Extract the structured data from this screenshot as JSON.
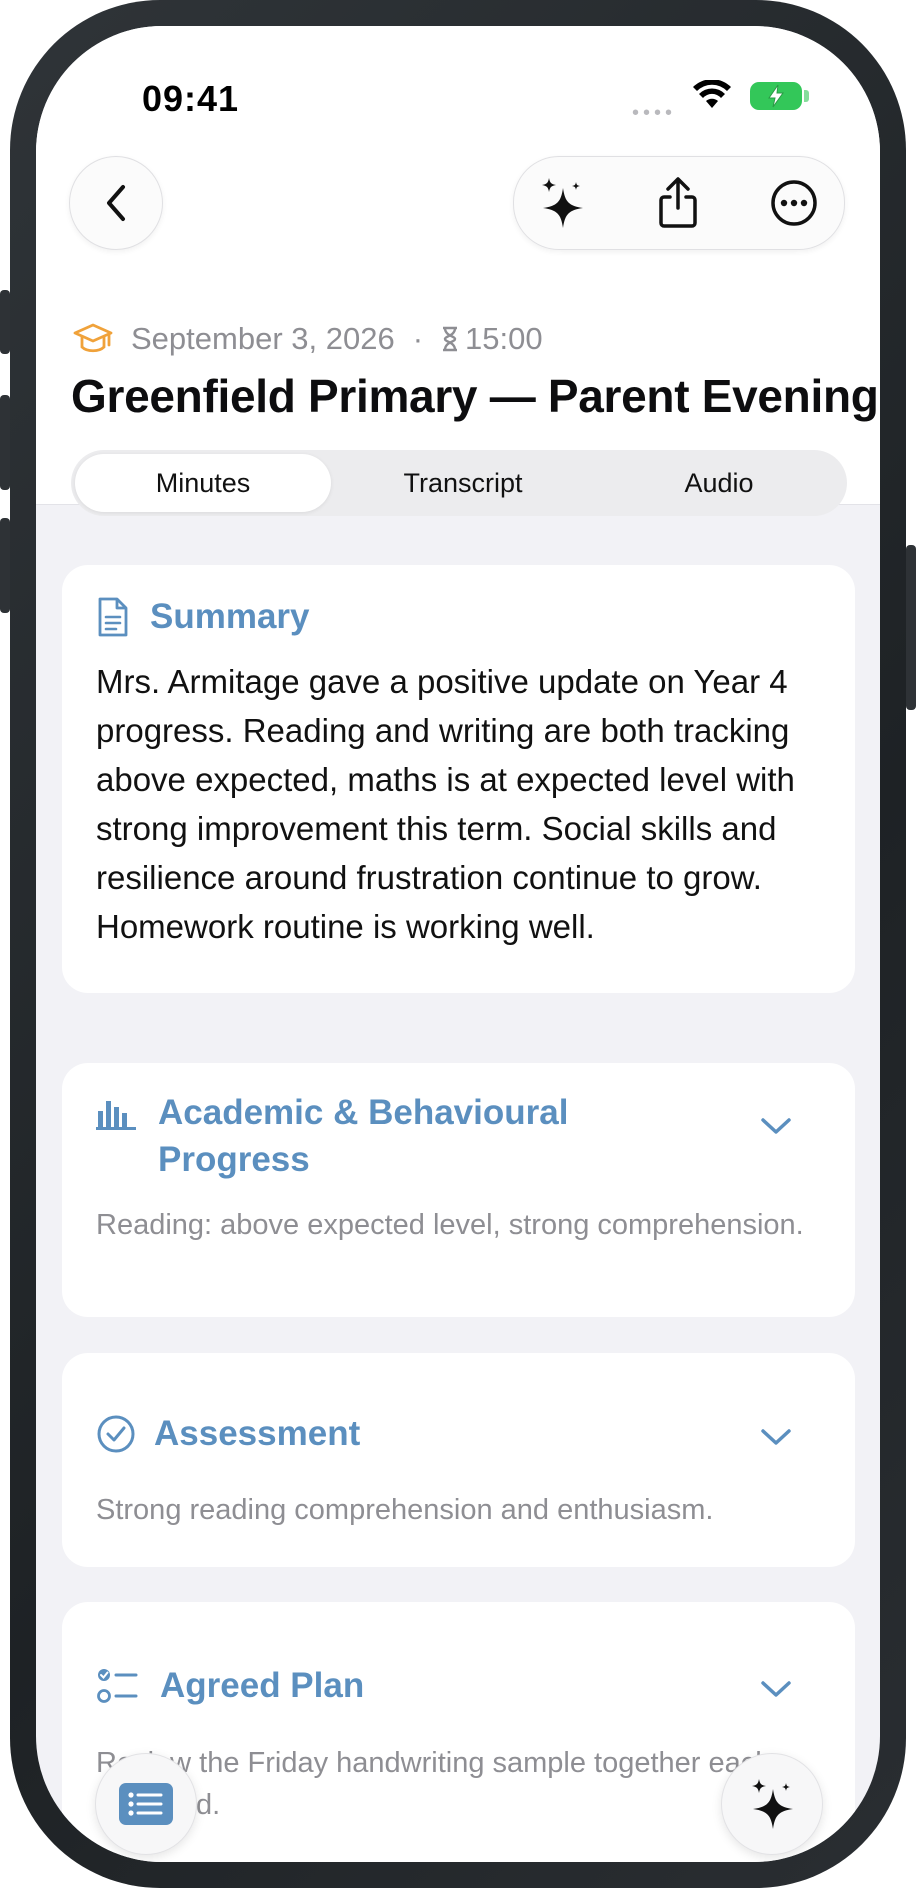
{
  "status_bar": {
    "time": "09:41",
    "signal": "••••"
  },
  "nav": {
    "back_icon": "chevron-left-icon",
    "actions": [
      "sparkles-icon",
      "share-icon",
      "more-icon"
    ]
  },
  "meeting": {
    "date": "September 3, 2026",
    "separator": "·",
    "duration": "15:00",
    "title": "Greenfield Primary — Parent Evening"
  },
  "tabs": [
    {
      "label": "Minutes",
      "active": true
    },
    {
      "label": "Transcript",
      "active": false
    },
    {
      "label": "Audio",
      "active": false
    }
  ],
  "summary": {
    "title": "Summary",
    "text": "Mrs. Armitage gave a positive update on Year 4 progress. Reading and writing are both tracking above expected, maths is at expected level with strong improvement this term. Social skills and resilience around frustration continue to grow. Homework routine is working well."
  },
  "sections": [
    {
      "title": "Academic & Behavioural Progress",
      "preview": "Reading: above expected level, strong comprehension."
    },
    {
      "title": "Assessment",
      "preview": "Strong reading comprehension and enthusiasm."
    },
    {
      "title": "Agreed Plan",
      "preview": "Review the Friday handwriting sample together each weekend."
    }
  ],
  "colors": {
    "accent": "#5b8fbf",
    "meta_icon": "#f0a23a",
    "battery": "#33c759"
  }
}
